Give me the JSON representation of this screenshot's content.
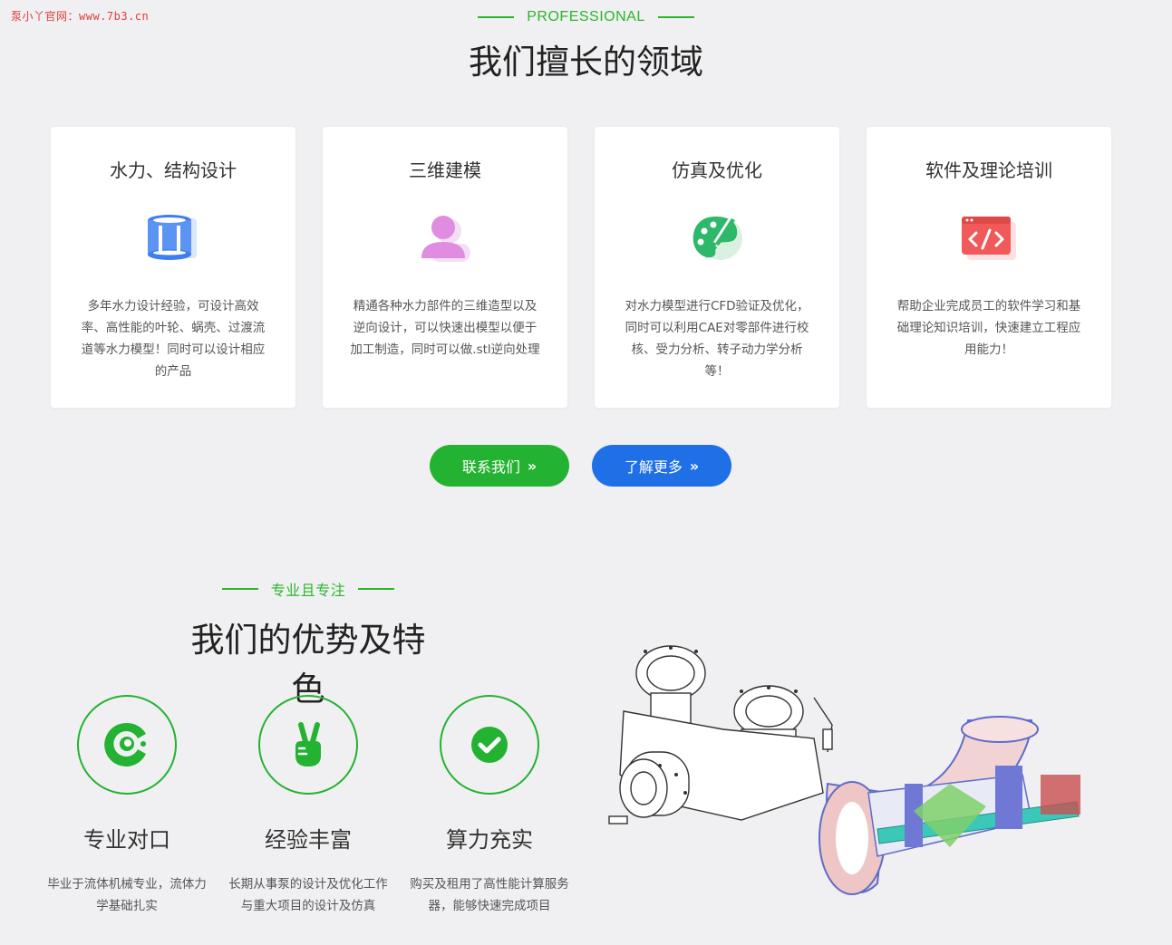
{
  "watermark": "泵小丫官网：www.7b3.cn",
  "section1": {
    "eyebrow": "PROFESSIONAL",
    "title": "我们擅长的领域",
    "cards": [
      {
        "title": "水力、结构设计",
        "icon": "cylinder-icon",
        "desc": "多年水力设计经验，可设计高效率、高性能的叶轮、蜗壳、过渡流道等水力模型！同时可以设计相应的产品"
      },
      {
        "title": "三维建模",
        "icon": "user-icon",
        "desc": "精通各种水力部件的三维造型以及逆向设计，可以快速出模型以便于加工制造，同时可以做.stl逆向处理"
      },
      {
        "title": "仿真及优化",
        "icon": "palette-icon",
        "desc": "对水力模型进行CFD验证及优化，同时可以利用CAE对零部件进行校核、受力分析、转子动力学分析等！"
      },
      {
        "title": "软件及理论培训",
        "icon": "code-icon",
        "desc": "帮助企业完成员工的软件学习和基础理论知识培训，快速建立工程应用能力！"
      }
    ],
    "buttons": {
      "contact": "联系我们",
      "more": "了解更多"
    }
  },
  "section2": {
    "eyebrow": "专业且专注",
    "title": "我们的优势及特色",
    "features": [
      {
        "title": "专业对口",
        "icon": "pacman-c-icon",
        "desc": "毕业于流体机械专业，流体力学基础扎实"
      },
      {
        "title": "经验丰富",
        "icon": "victory-hand-icon",
        "desc": "长期从事泵的设计及优化工作与重大项目的设计及仿真"
      },
      {
        "title": "算力充实",
        "icon": "check-circle-icon",
        "desc": "购买及租用了高性能计算服务器，能够快速完成项目"
      }
    ]
  },
  "colors": {
    "green": "#23b231",
    "blue": "#1f6fe6",
    "background": "#f0f0f2",
    "card": "#ffffff"
  }
}
